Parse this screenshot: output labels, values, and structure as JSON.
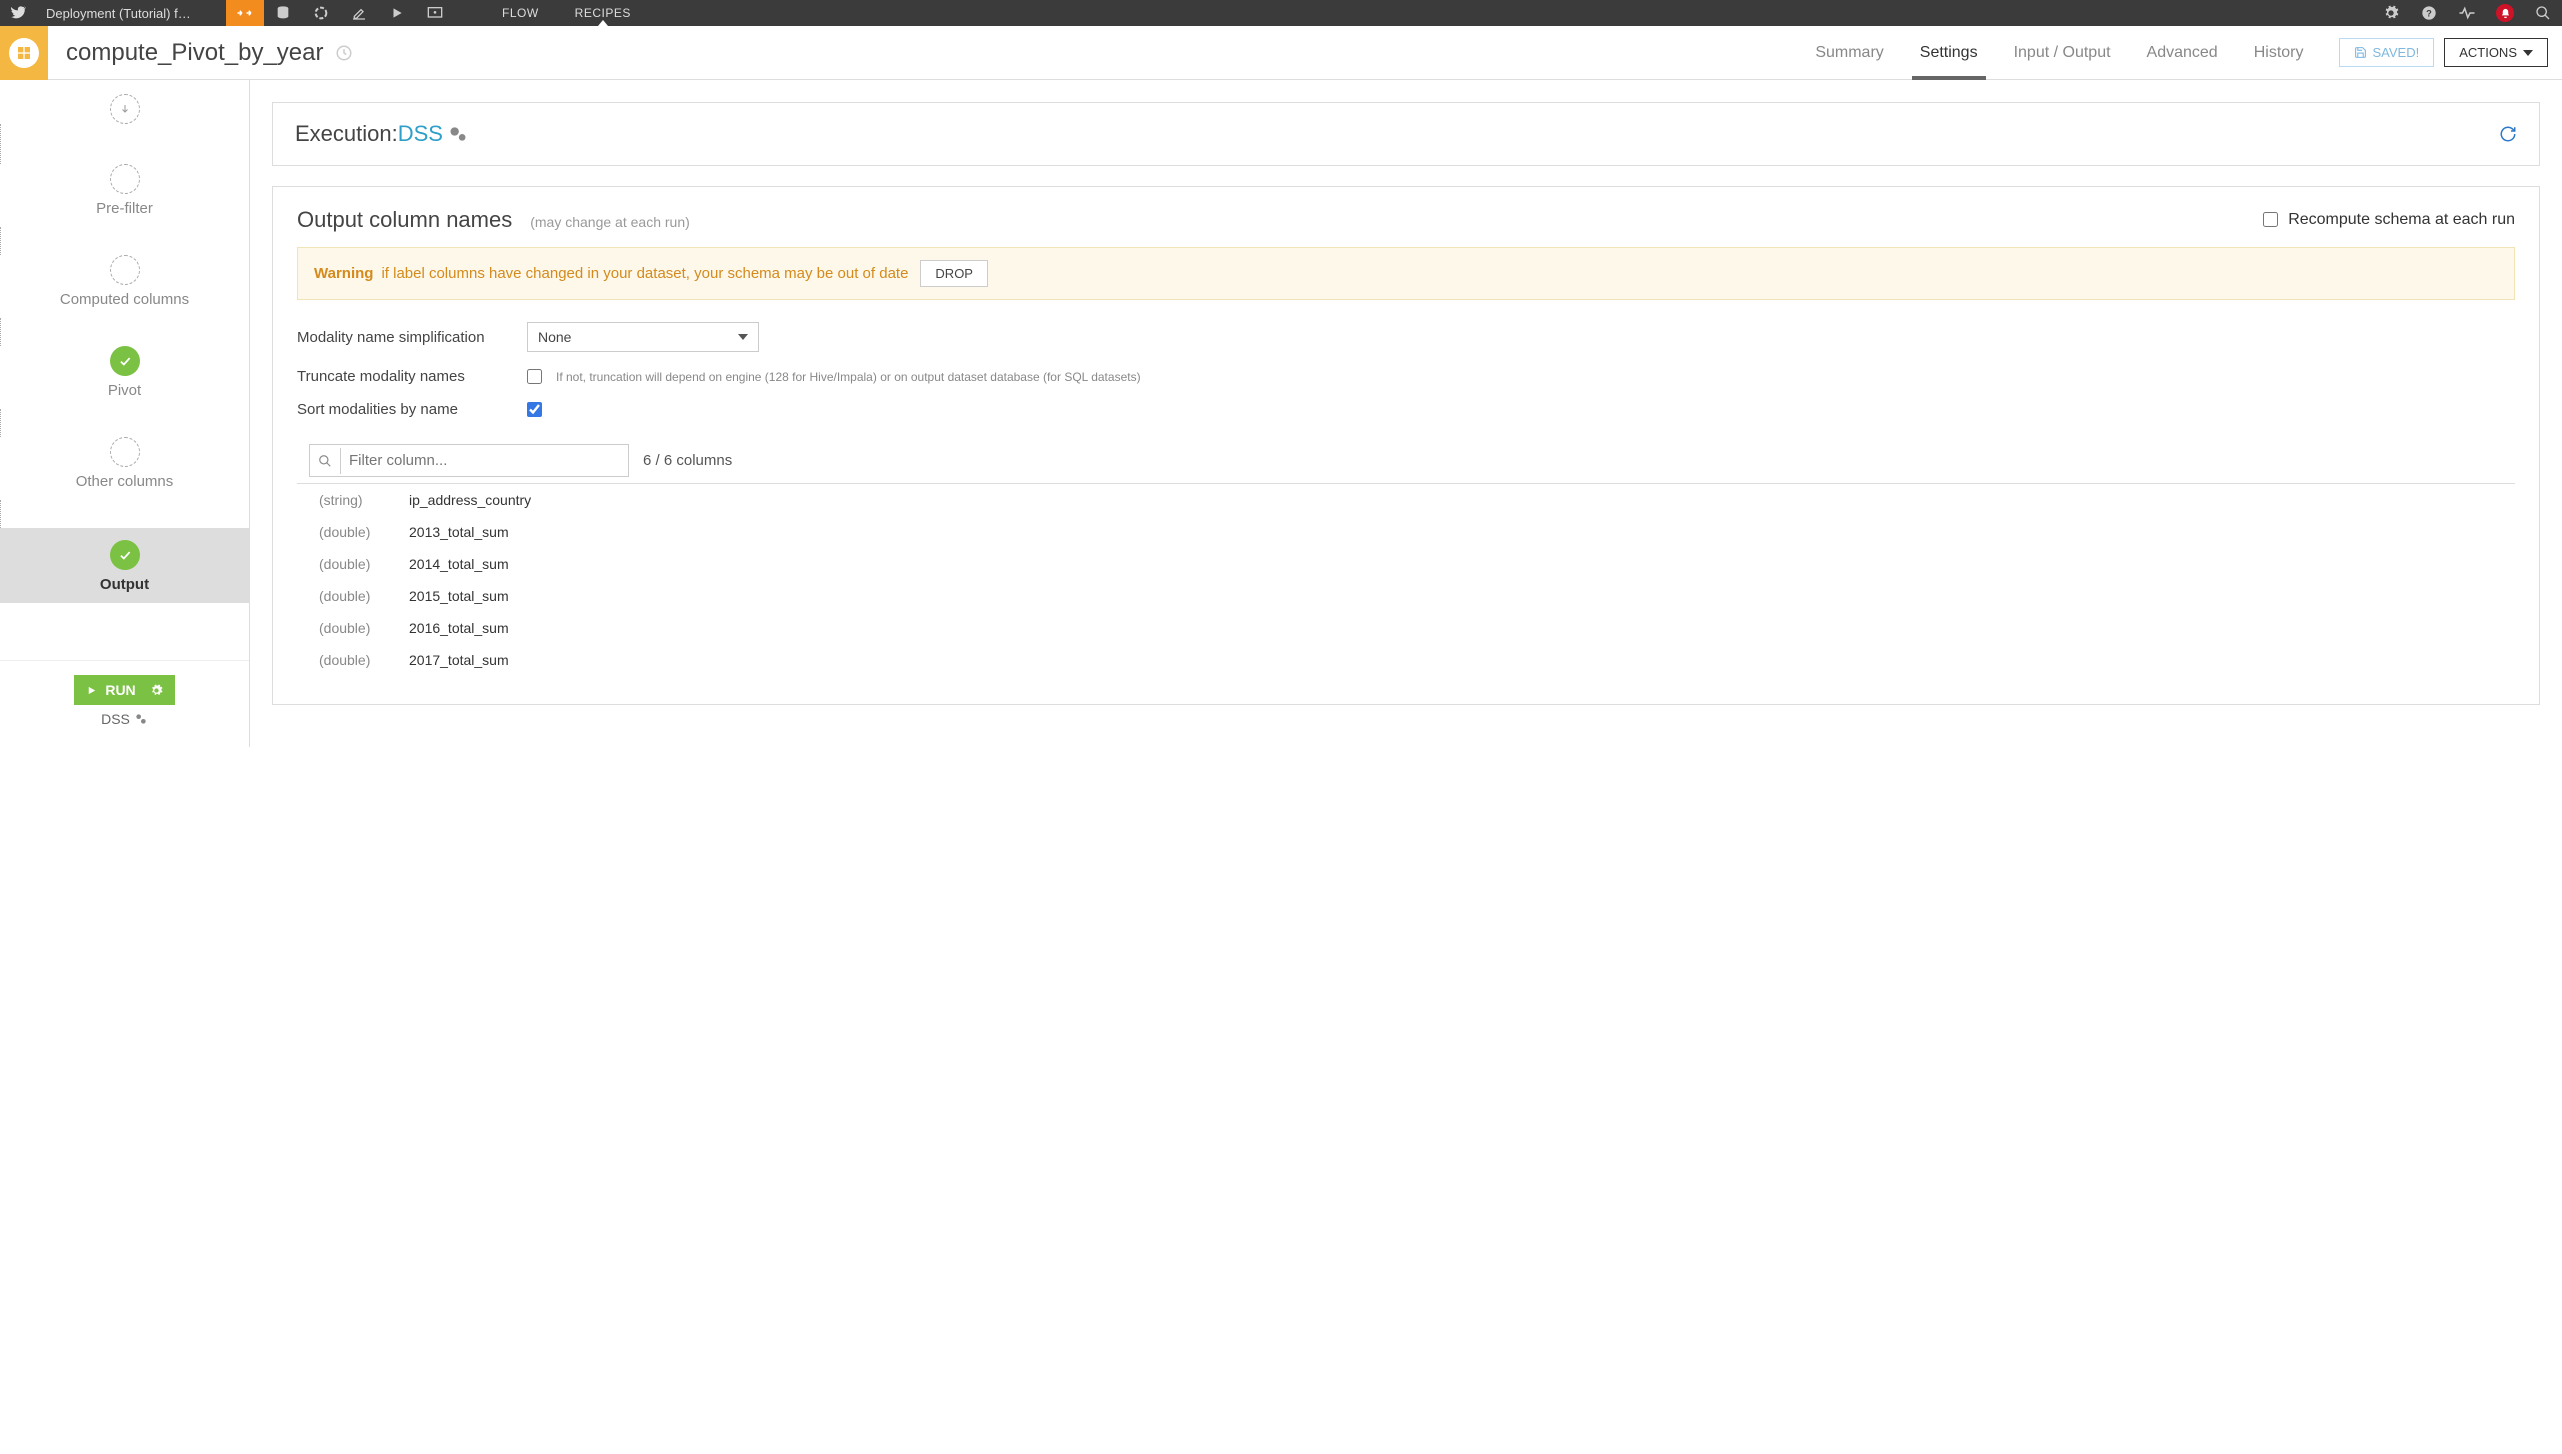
{
  "topbar": {
    "project": "Deployment (Tutorial) f…",
    "menu_flow": "FLOW",
    "menu_recipes": "RECIPES"
  },
  "titlebar": {
    "title": "compute_Pivot_by_year",
    "tabs": {
      "summary": "Summary",
      "settings": "Settings",
      "io": "Input / Output",
      "advanced": "Advanced",
      "history": "History"
    },
    "saved": "SAVED!",
    "actions": "ACTIONS"
  },
  "sidebar": {
    "steps": {
      "prefilter": "Pre-filter",
      "computed": "Computed columns",
      "pivot": "Pivot",
      "other": "Other columns",
      "output": "Output"
    },
    "run": "RUN",
    "dss": "DSS"
  },
  "exec": {
    "label": "Execution: ",
    "engine": "DSS"
  },
  "output": {
    "title": "Output column names",
    "subtitle": "(may change at each run)",
    "recompute_label": "Recompute schema at each run",
    "warning_label": "Warning",
    "warning_text": " if label columns have changed in your dataset, your schema may be out of date",
    "drop": "DROP",
    "modality_label": "Modality name simplification",
    "modality_value": "None",
    "truncate_label": "Truncate modality names",
    "truncate_hint": "If not, truncation will depend on engine (128 for Hive/Impala) or on output dataset database (for SQL datasets)",
    "sort_label": "Sort modalities by name",
    "filter_placeholder": "Filter column...",
    "count_text": "6 / 6 columns",
    "cols": [
      {
        "type": "(string)",
        "name": "ip_address_country"
      },
      {
        "type": "(double)",
        "name": "2013_total_sum"
      },
      {
        "type": "(double)",
        "name": "2014_total_sum"
      },
      {
        "type": "(double)",
        "name": "2015_total_sum"
      },
      {
        "type": "(double)",
        "name": "2016_total_sum"
      },
      {
        "type": "(double)",
        "name": "2017_total_sum"
      }
    ]
  }
}
